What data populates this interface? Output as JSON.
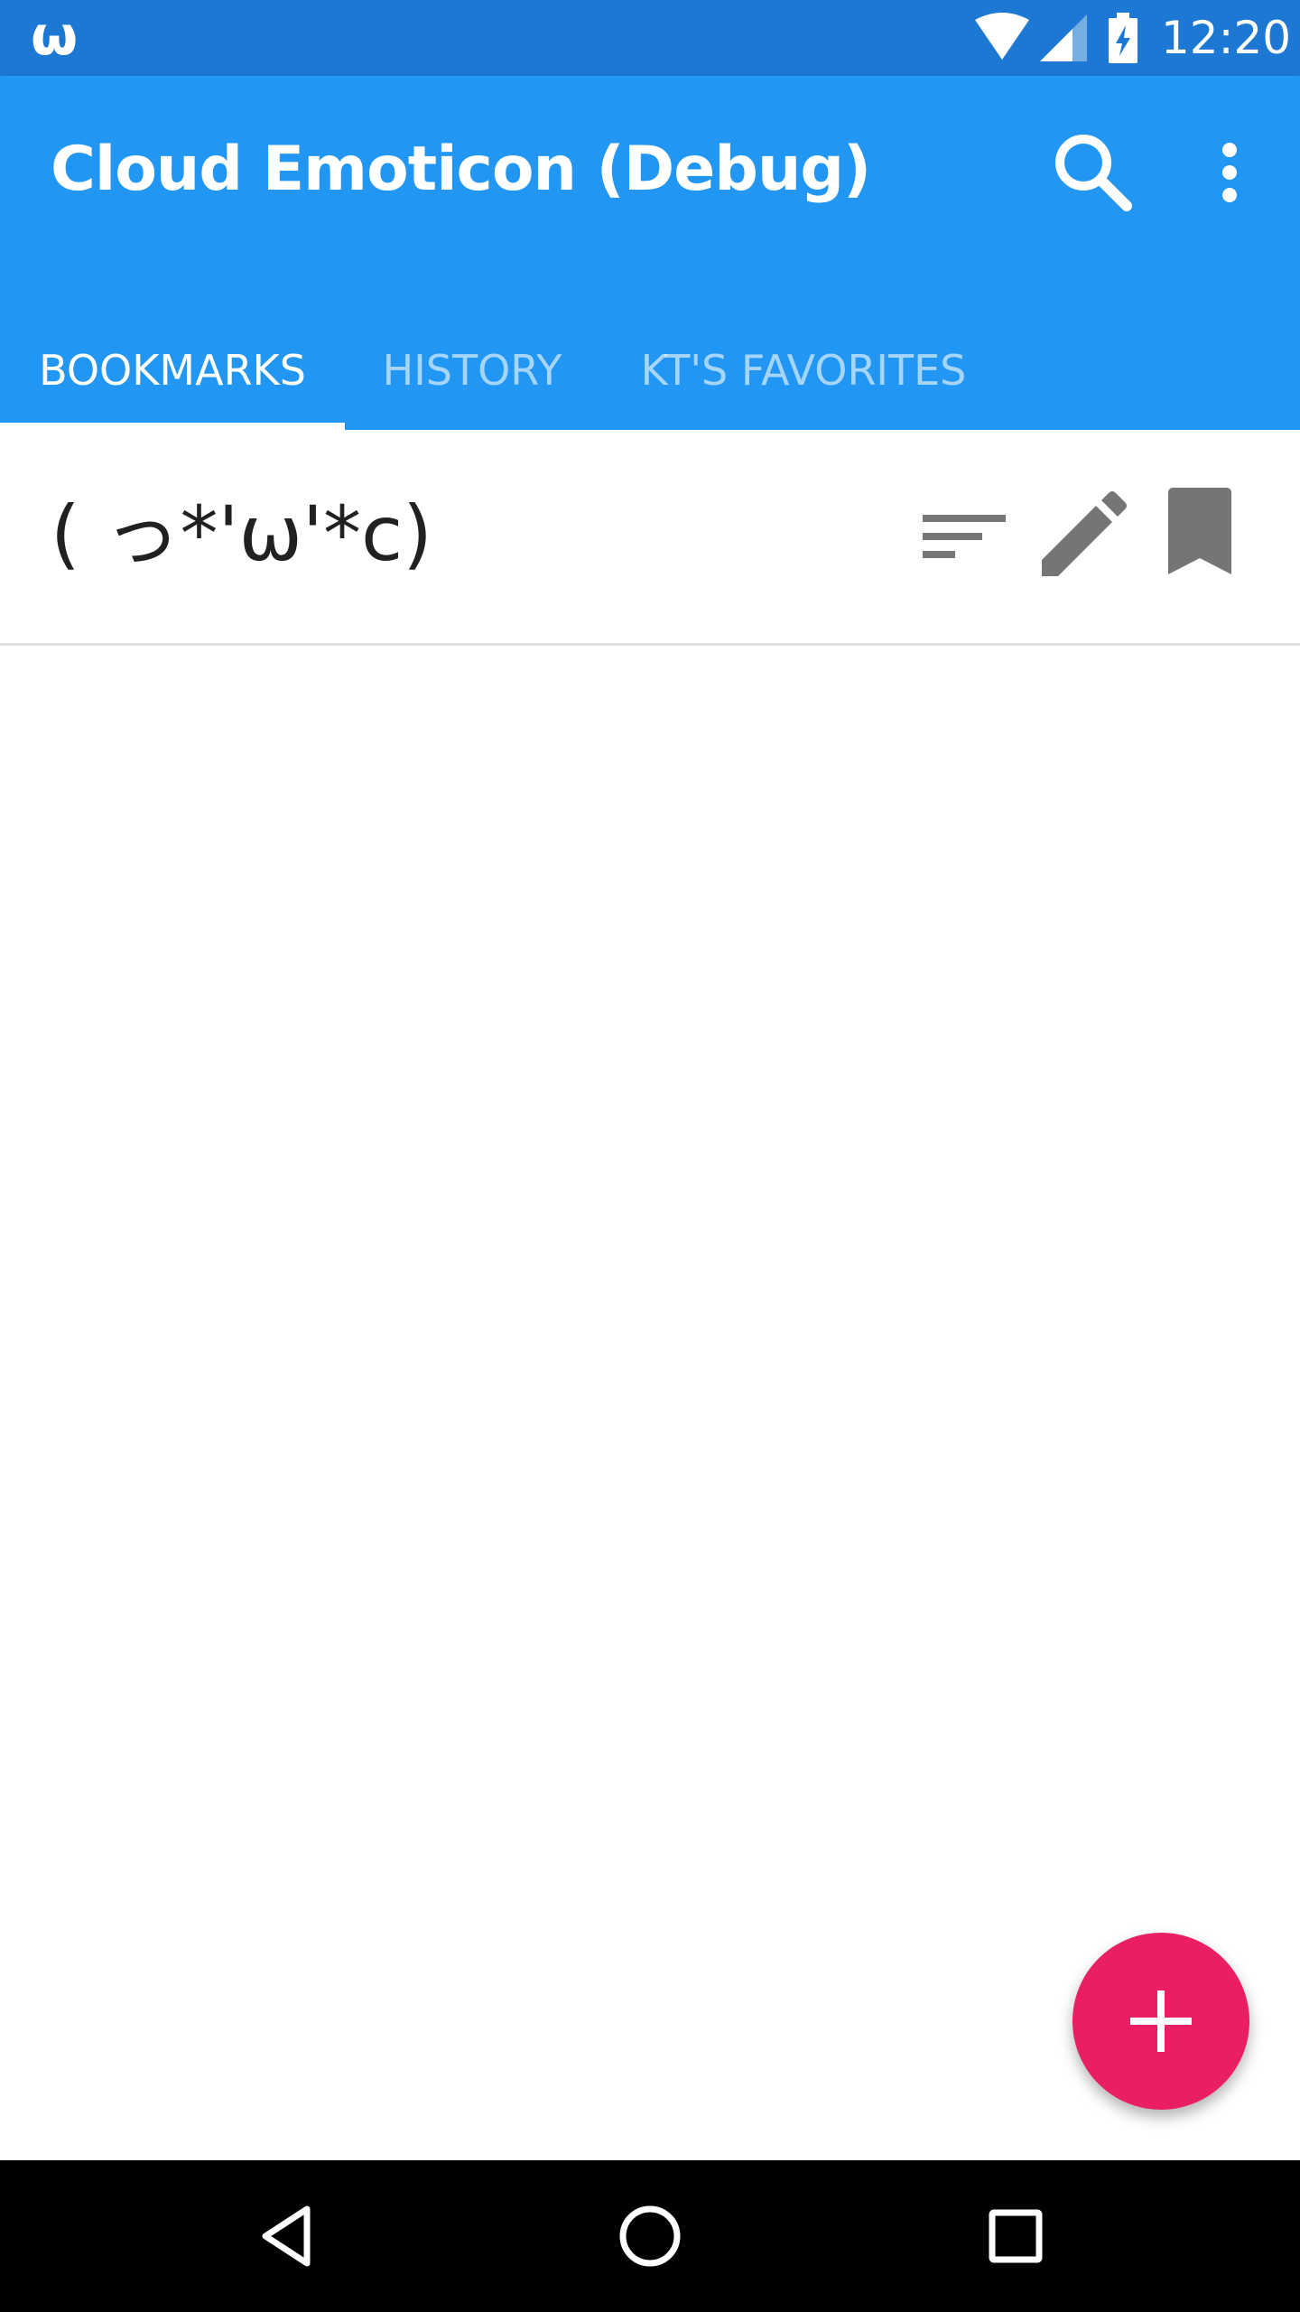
{
  "status_bar": {
    "app_icon_glyph": "ω",
    "time": "12:20",
    "icons": [
      "wifi-icon",
      "signal-icon",
      "battery-charging-icon"
    ]
  },
  "app_bar": {
    "title": "Cloud Emoticon (Debug)",
    "actions": [
      "search-icon",
      "more-vert-icon"
    ]
  },
  "tabs": [
    {
      "label": "BOOKMARKS",
      "active": true
    },
    {
      "label": "HISTORY",
      "active": false
    },
    {
      "label": "KT'S FAVORITES",
      "active": false
    }
  ],
  "bookmarks": [
    {
      "emoticon": "( っ*'ω'*c)",
      "actions": [
        "sort-icon",
        "edit-icon",
        "bookmark-icon"
      ]
    }
  ],
  "fab": {
    "icon": "add-icon"
  },
  "nav_bar": {
    "icons": [
      "back-icon",
      "home-icon",
      "recents-icon"
    ]
  },
  "colors": {
    "status_bar": "#1c78d3",
    "primary": "#2196f3",
    "accent": "#e91e63",
    "icon_gray": "#757575",
    "text": "#212121",
    "divider": "#e0e0e0"
  }
}
